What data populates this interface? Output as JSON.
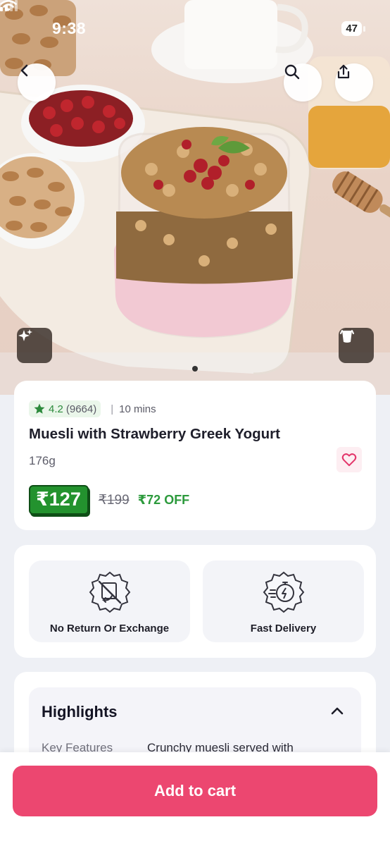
{
  "status_bar": {
    "time": "9:38",
    "battery": "47"
  },
  "hero": {
    "carousel_dots": 1
  },
  "product": {
    "rating": "4.2",
    "rating_count": "(9664)",
    "delivery_time": "10 mins",
    "name": "Muesli with Strawberry Greek Yogurt",
    "weight": "176g",
    "price": "₹127",
    "mrp": "₹199",
    "discount": "₹72 OFF"
  },
  "policies": [
    {
      "label": "No Return Or Exchange",
      "icon": "no-return-icon"
    },
    {
      "label": "Fast Delivery",
      "icon": "fast-delivery-icon"
    }
  ],
  "highlights": {
    "title": "Highlights",
    "rows": [
      {
        "key": "Key Features",
        "value": "Crunchy muesli served with"
      }
    ]
  },
  "cta": {
    "add_to_cart": "Add to cart"
  },
  "colors": {
    "brand_pink": "#ec4770",
    "price_green": "#23922e",
    "rating_green": "#2c8a3c",
    "background": "#eef0f5"
  }
}
